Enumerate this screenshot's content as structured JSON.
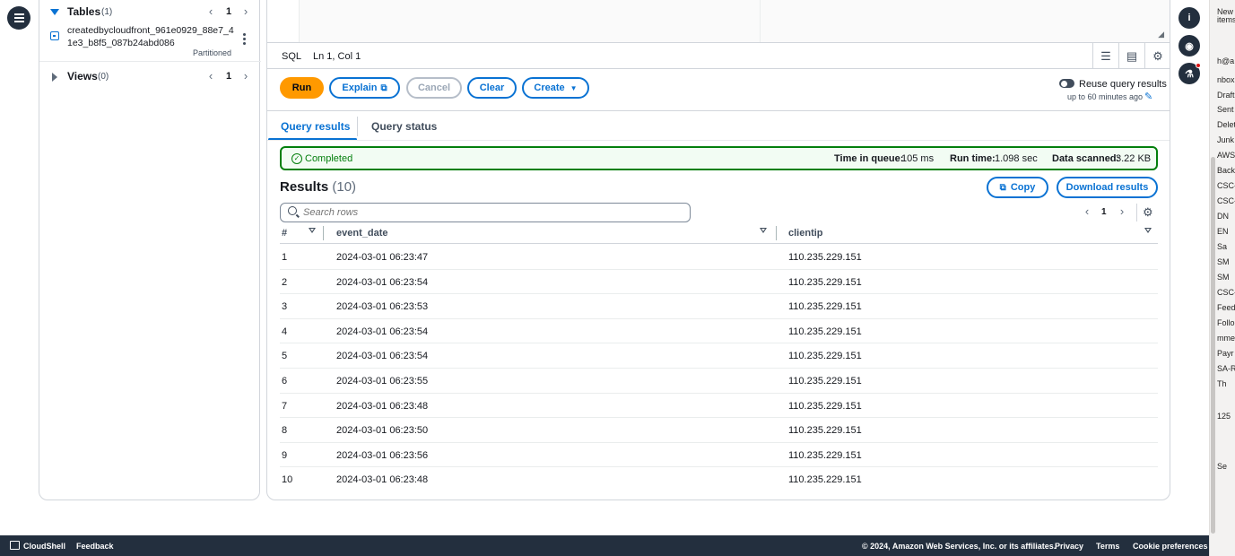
{
  "left_panel": {
    "tables": {
      "title": "Tables",
      "count": "(1)",
      "page": "1"
    },
    "table_item": {
      "name_line1": "createdbycloudfront_961e0929_88e7_4",
      "name_line2": "1e3_b8f5_087b24abd086",
      "badge": "Partitioned"
    },
    "views": {
      "title": "Views",
      "count": "(0)",
      "page": "1"
    }
  },
  "editor": {
    "language": "SQL",
    "cursor": "Ln 1, Col 1"
  },
  "actions": {
    "run": "Run",
    "explain": "Explain",
    "cancel": "Cancel",
    "clear": "Clear",
    "create": "Create",
    "reuse_label": "Reuse query results",
    "reuse_sub": "up to 60 minutes ago"
  },
  "tabs": [
    "Query results",
    "Query status"
  ],
  "status": {
    "text": "Completed",
    "queue_label": "Time in queue:",
    "queue_value": "105 ms",
    "run_label": "Run time:",
    "run_value": "1.098 sec",
    "scanned_label": "Data scanned:",
    "scanned_value": "3.22 KB"
  },
  "results": {
    "title": "Results",
    "count": "(10)",
    "copy": "Copy",
    "download": "Download results",
    "search_placeholder": "Search rows",
    "page": "1",
    "columns": [
      "#",
      "event_date",
      "clientip"
    ],
    "rows": [
      [
        "1",
        "2024-03-01 06:23:47",
        "110.235.229.151"
      ],
      [
        "2",
        "2024-03-01 06:23:54",
        "110.235.229.151"
      ],
      [
        "3",
        "2024-03-01 06:23:53",
        "110.235.229.151"
      ],
      [
        "4",
        "2024-03-01 06:23:54",
        "110.235.229.151"
      ],
      [
        "5",
        "2024-03-01 06:23:54",
        "110.235.229.151"
      ],
      [
        "6",
        "2024-03-01 06:23:55",
        "110.235.229.151"
      ],
      [
        "7",
        "2024-03-01 06:23:48",
        "110.235.229.151"
      ],
      [
        "8",
        "2024-03-01 06:23:50",
        "110.235.229.151"
      ],
      [
        "9",
        "2024-03-01 06:23:56",
        "110.235.229.151"
      ],
      [
        "10",
        "2024-03-01 06:23:48",
        "110.235.229.151"
      ]
    ]
  },
  "side_strip": {
    "items": [
      "New",
      "items",
      "h@a",
      "nbox",
      "Draft",
      "Sent",
      "Delet",
      "Junk",
      "AWS-",
      "Back",
      "CSC-",
      "CSC-",
      "DN",
      "EN",
      "Sa",
      "SM",
      "SM",
      "CSC-",
      "Feed",
      "Follo",
      "mme",
      "Payr",
      "SA-R",
      "Th",
      "125",
      "Se"
    ]
  },
  "footer": {
    "cloudshell": "CloudShell",
    "feedback": "Feedback",
    "copyright": "© 2024, Amazon Web Services, Inc. or its affiliates.",
    "privacy": "Privacy",
    "terms": "Terms",
    "cookies": "Cookie preferences"
  },
  "colors": {
    "accent": "#0972d3",
    "primary_button": "#ff9900",
    "success": "#037f0c",
    "dark_nav": "#232f3e"
  }
}
